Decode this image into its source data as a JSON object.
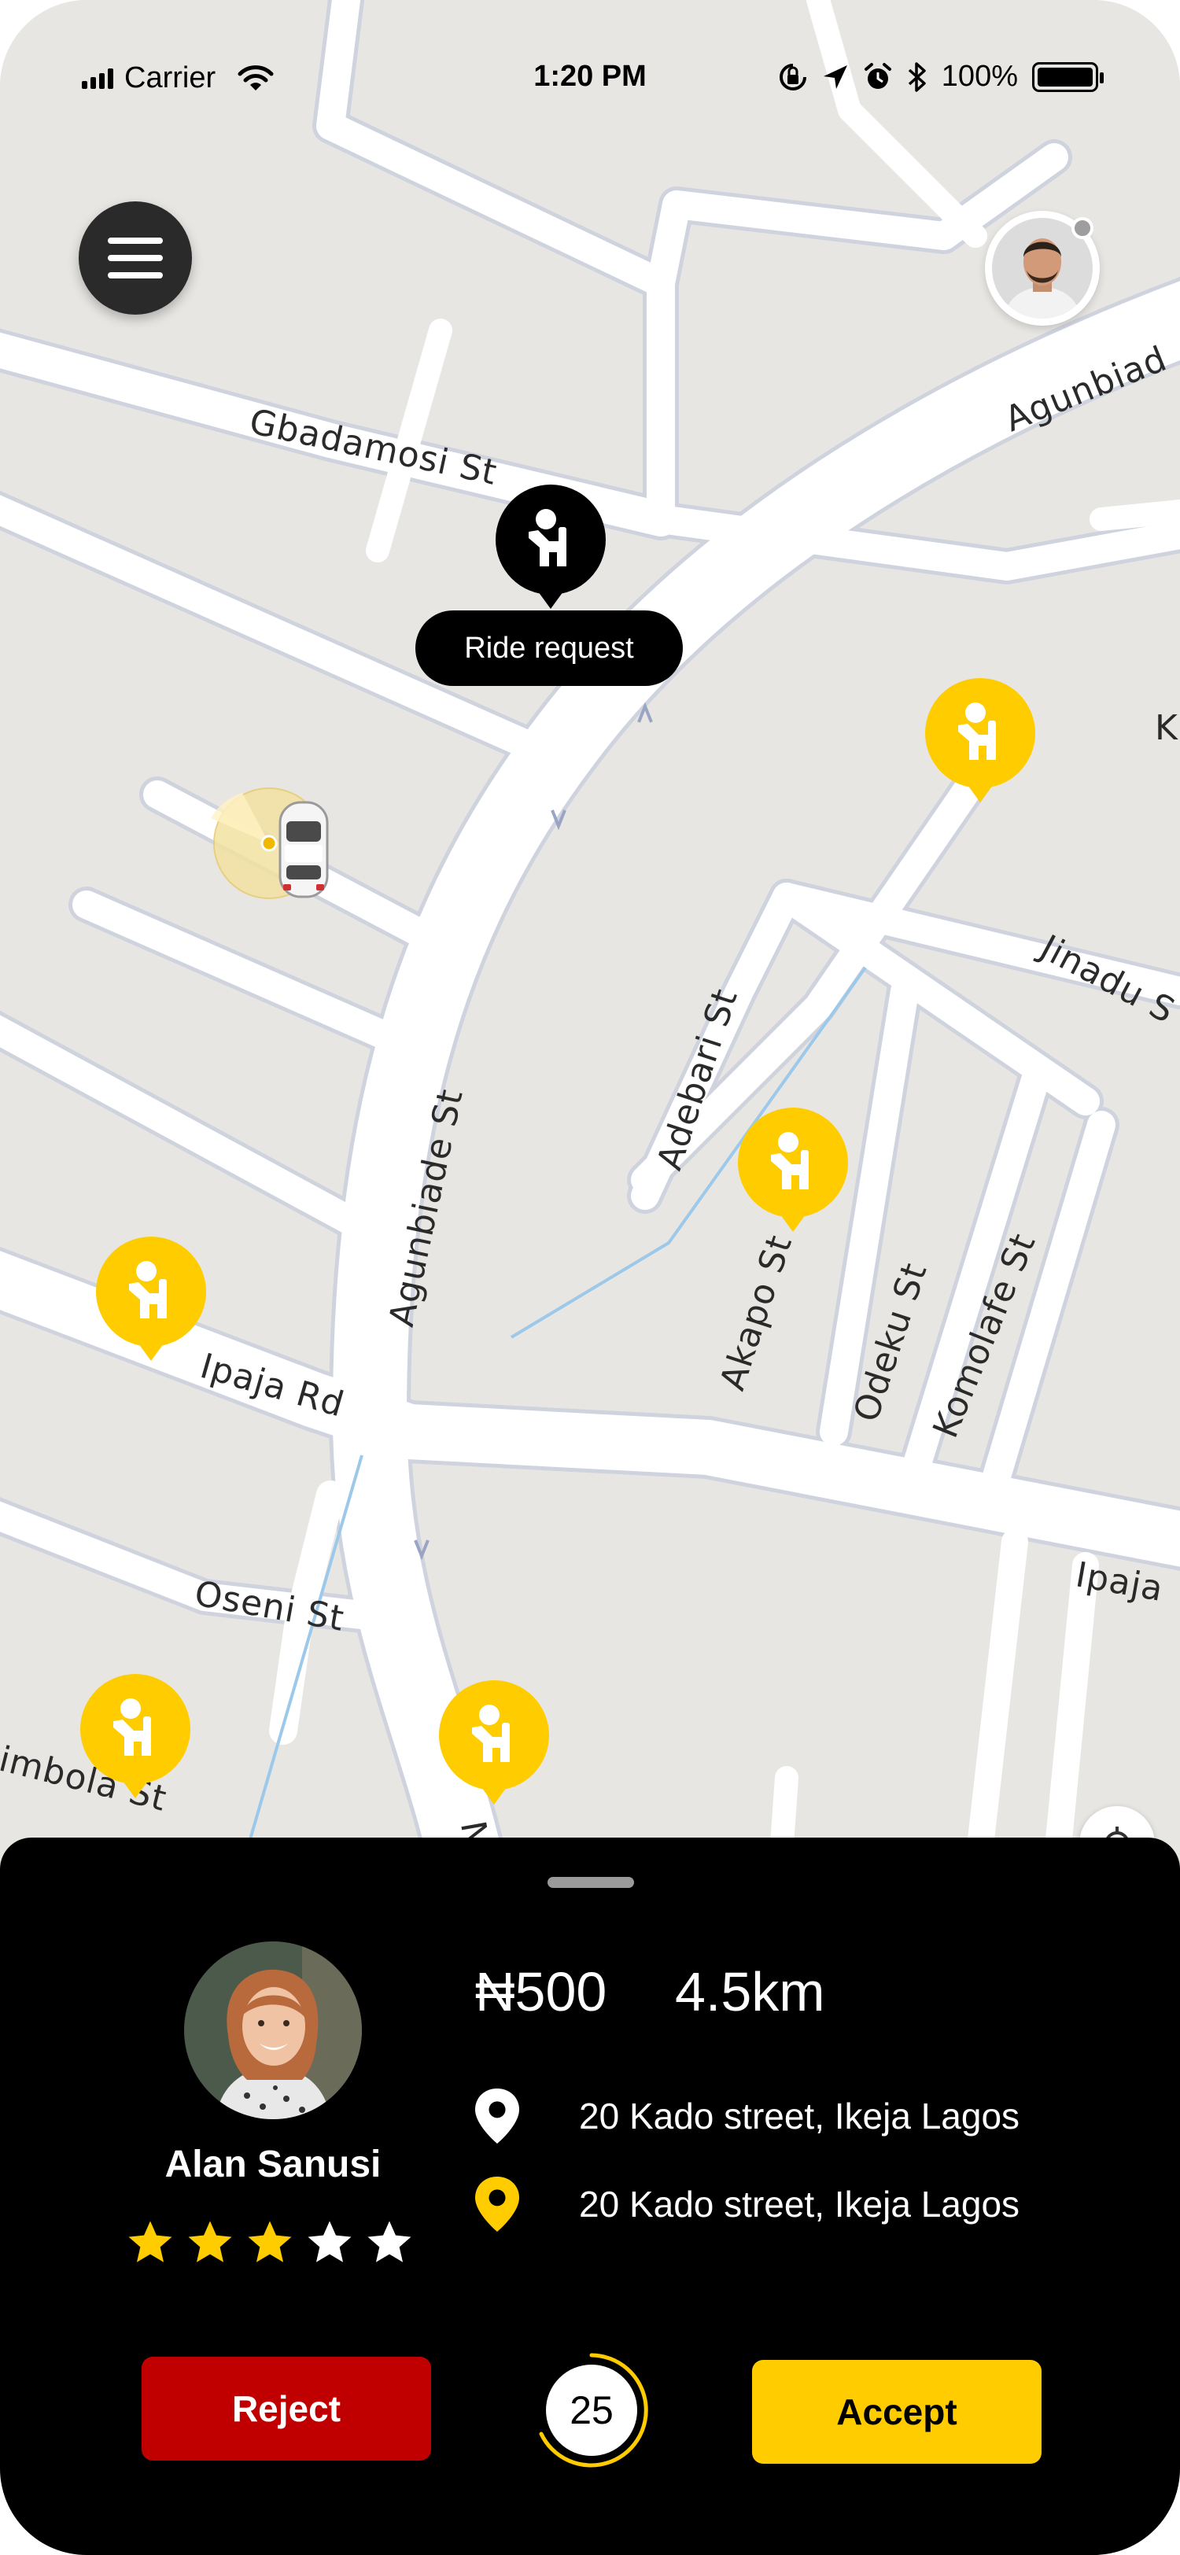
{
  "status_bar": {
    "carrier": "Carrier",
    "time": "1:20 PM",
    "battery": "100%"
  },
  "map": {
    "street_labels": [
      "Gbadamosi St",
      "Agunbiade St",
      "Agunbiad",
      "Adebari St",
      "Jinadu S",
      "Akapo St",
      "Odeku St",
      "Komolafe St",
      "Ipaja Rd",
      "Ipaja",
      "Oseni St",
      "imbola St",
      "K",
      "NU"
    ],
    "request_label": "Ride request"
  },
  "icons": {
    "menu": "hamburger-menu-icon",
    "rider_pin": "waving-person-pin-icon",
    "car": "car-icon",
    "location_pin": "location-pin-icon",
    "star": "star-icon"
  },
  "colors": {
    "accent": "#FFCC00",
    "reject": "#C00000",
    "sheet_bg": "#000000",
    "map_bg": "#E8E6E3",
    "road": "#FFFFFF"
  },
  "rider": {
    "name": "Alan Sanusi",
    "rating": 3,
    "rating_max": 5
  },
  "trip": {
    "fare": "₦500",
    "distance": "4.5km",
    "pickup": "20 Kado street, Ikeja Lagos",
    "destination": "20 Kado street, Ikeja Lagos"
  },
  "actions": {
    "reject": "Reject",
    "accept": "Accept",
    "timer": "25"
  }
}
